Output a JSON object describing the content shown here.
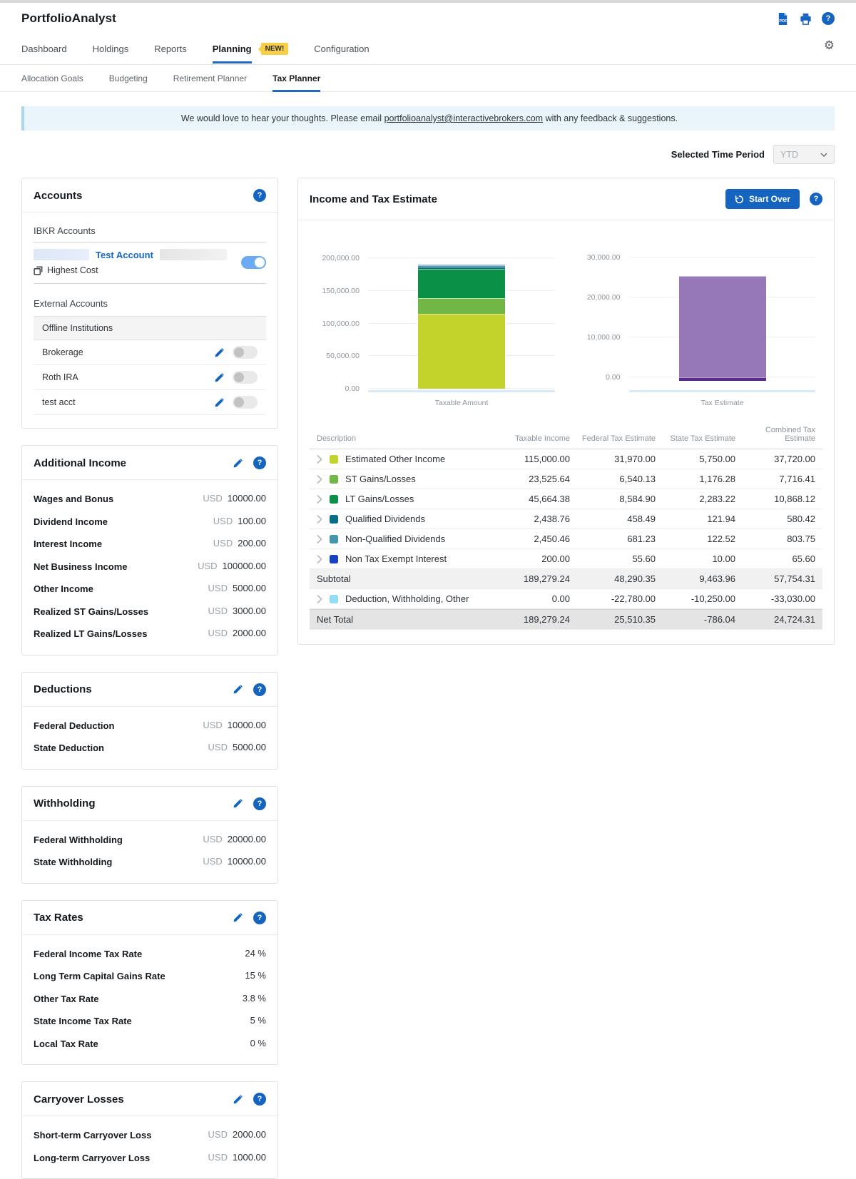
{
  "header": {
    "app_title": "PortfolioAnalyst"
  },
  "nav": {
    "tabs": [
      {
        "label": "Dashboard",
        "active": false
      },
      {
        "label": "Holdings",
        "active": false
      },
      {
        "label": "Reports",
        "active": false
      },
      {
        "label": "Planning",
        "active": true,
        "badge": "NEW!"
      },
      {
        "label": "Configuration",
        "active": false
      }
    ]
  },
  "subnav": {
    "tabs": [
      {
        "label": "Allocation Goals",
        "active": false
      },
      {
        "label": "Budgeting",
        "active": false
      },
      {
        "label": "Retirement Planner",
        "active": false
      },
      {
        "label": "Tax Planner",
        "active": true
      }
    ]
  },
  "banner": {
    "text_before": "We would love to hear your thoughts. Please email",
    "email": "portfolioanalyst@interactivebrokers.com",
    "text_after": "with any feedback & suggestions."
  },
  "time_period": {
    "label": "Selected Time Period",
    "value": "YTD"
  },
  "accounts": {
    "title": "Accounts",
    "ibkr_heading": "IBKR Accounts",
    "ibkr_account": {
      "name": "Test Account",
      "cost_method": "Highest Cost",
      "enabled": true
    },
    "external_heading": "External Accounts",
    "institution_group": "Offline Institutions",
    "external_accounts": [
      {
        "name": "Brokerage",
        "enabled": false
      },
      {
        "name": "Roth IRA",
        "enabled": false
      },
      {
        "name": "test acct",
        "enabled": false
      }
    ]
  },
  "value_panels": [
    {
      "title": "Additional Income",
      "rows": [
        {
          "label": "Wages and Bonus",
          "currency": "USD",
          "value": "10000.00"
        },
        {
          "label": "Dividend Income",
          "currency": "USD",
          "value": "100.00"
        },
        {
          "label": "Interest Income",
          "currency": "USD",
          "value": "200.00"
        },
        {
          "label": "Net Business Income",
          "currency": "USD",
          "value": "100000.00"
        },
        {
          "label": "Other Income",
          "currency": "USD",
          "value": "5000.00"
        },
        {
          "label": "Realized ST Gains/Losses",
          "currency": "USD",
          "value": "3000.00"
        },
        {
          "label": "Realized LT Gains/Losses",
          "currency": "USD",
          "value": "2000.00"
        }
      ]
    },
    {
      "title": "Deductions",
      "rows": [
        {
          "label": "Federal Deduction",
          "currency": "USD",
          "value": "10000.00"
        },
        {
          "label": "State Deduction",
          "currency": "USD",
          "value": "5000.00"
        }
      ]
    },
    {
      "title": "Withholding",
      "rows": [
        {
          "label": "Federal Withholding",
          "currency": "USD",
          "value": "20000.00"
        },
        {
          "label": "State Withholding",
          "currency": "USD",
          "value": "10000.00"
        }
      ]
    },
    {
      "title": "Tax Rates",
      "rows": [
        {
          "label": "Federal Income Tax Rate",
          "value": "24 %"
        },
        {
          "label": "Long Term Capital Gains Rate",
          "value": "15 %"
        },
        {
          "label": "Other Tax Rate",
          "value": "3.8 %"
        },
        {
          "label": "State Income Tax Rate",
          "value": "5 %"
        },
        {
          "label": "Local Tax Rate",
          "value": "0 %"
        }
      ]
    },
    {
      "title": "Carryover Losses",
      "rows": [
        {
          "label": "Short-term Carryover Loss",
          "currency": "USD",
          "value": "2000.00"
        },
        {
          "label": "Long-term Carryover Loss",
          "currency": "USD",
          "value": "1000.00"
        }
      ]
    }
  ],
  "estimate": {
    "title": "Income and Tax Estimate",
    "start_over_label": "Start Over",
    "table": {
      "columns": [
        "Description",
        "Taxable Income",
        "Federal Tax Estimate",
        "State Tax Estimate",
        "Combined Tax Estimate"
      ],
      "rows": [
        {
          "type": "data",
          "label": "Estimated Other Income",
          "color": "#c3d32b",
          "values": [
            "115,000.00",
            "31,970.00",
            "5,750.00",
            "37,720.00"
          ]
        },
        {
          "type": "data",
          "label": "ST Gains/Losses",
          "color": "#72b746",
          "values": [
            "23,525.64",
            "6,540.13",
            "1,176.28",
            "7,716.41"
          ]
        },
        {
          "type": "data",
          "label": "LT Gains/Losses",
          "color": "#0b9048",
          "values": [
            "45,664.38",
            "8,584.90",
            "2,283.22",
            "10,868.12"
          ]
        },
        {
          "type": "data",
          "label": "Qualified Dividends",
          "color": "#0a6e87",
          "values": [
            "2,438.76",
            "458.49",
            "121.94",
            "580.42"
          ]
        },
        {
          "type": "data",
          "label": "Non-Qualified Dividends",
          "color": "#4596ad",
          "values": [
            "2,450.46",
            "681.23",
            "122.52",
            "803.75"
          ]
        },
        {
          "type": "data",
          "label": "Non Tax Exempt Interest",
          "color": "#1843bf",
          "values": [
            "200.00",
            "55.60",
            "10.00",
            "65.60"
          ]
        },
        {
          "type": "subtotal",
          "label": "Subtotal",
          "values": [
            "189,279.24",
            "48,290.35",
            "9,463.96",
            "57,754.31"
          ]
        },
        {
          "type": "data",
          "label": "Deduction, Withholding, Other",
          "color": "#93dcf8",
          "values": [
            "0.00",
            "-22,780.00",
            "-10,250.00",
            "-33,030.00"
          ]
        },
        {
          "type": "net",
          "label": "Net Total",
          "values": [
            "189,279.24",
            "25,510.35",
            "-786.04",
            "24,724.31"
          ]
        }
      ]
    }
  },
  "chart_data": [
    {
      "type": "bar",
      "stacked": true,
      "x_label": "Taxable Amount",
      "axis_range": [
        0,
        200000
      ],
      "plot_range": [
        0,
        210000
      ],
      "grid": true,
      "ticks": [
        {
          "value": 0,
          "label": "0.00"
        },
        {
          "value": 50000,
          "label": "50,000.00"
        },
        {
          "value": 100000,
          "label": "100,000.00"
        },
        {
          "value": 150000,
          "label": "150,000.00"
        },
        {
          "value": 200000,
          "label": "200,000.00"
        }
      ],
      "segments": [
        {
          "name": "Estimated Other Income",
          "value": 115000.0,
          "color": "#c3d32b"
        },
        {
          "name": "ST Gains/Losses",
          "value": 23525.64,
          "color": "#72b746"
        },
        {
          "name": "LT Gains/Losses",
          "value": 45664.38,
          "color": "#0b9048"
        },
        {
          "name": "Qualified Dividends",
          "value": 2438.76,
          "color": "#0a6e87"
        },
        {
          "name": "Non-Qualified Dividends",
          "value": 2450.46,
          "color": "#4596ad"
        },
        {
          "name": "Non Tax Exempt Interest",
          "value": 200.0,
          "color": "#1843bf"
        }
      ],
      "total": 189279.24
    },
    {
      "type": "bar",
      "stacked": true,
      "x_label": "Tax Estimate",
      "axis_range": [
        0,
        30000
      ],
      "plot_range": [
        -2800,
        31500
      ],
      "grid": true,
      "ticks": [
        {
          "value": 0,
          "label": "0.00"
        },
        {
          "value": 10000,
          "label": "10,000.00"
        },
        {
          "value": 20000,
          "label": "20,000.00"
        },
        {
          "value": 30000,
          "label": "30,000.00"
        }
      ],
      "segments": [
        {
          "name": "Federal Tax Estimate",
          "value": 25510.35,
          "color": "#9678b8"
        },
        {
          "name": "State Tax Estimate",
          "value": -786.04,
          "color": "#5a2a8c"
        }
      ],
      "total": 24724.31
    }
  ]
}
